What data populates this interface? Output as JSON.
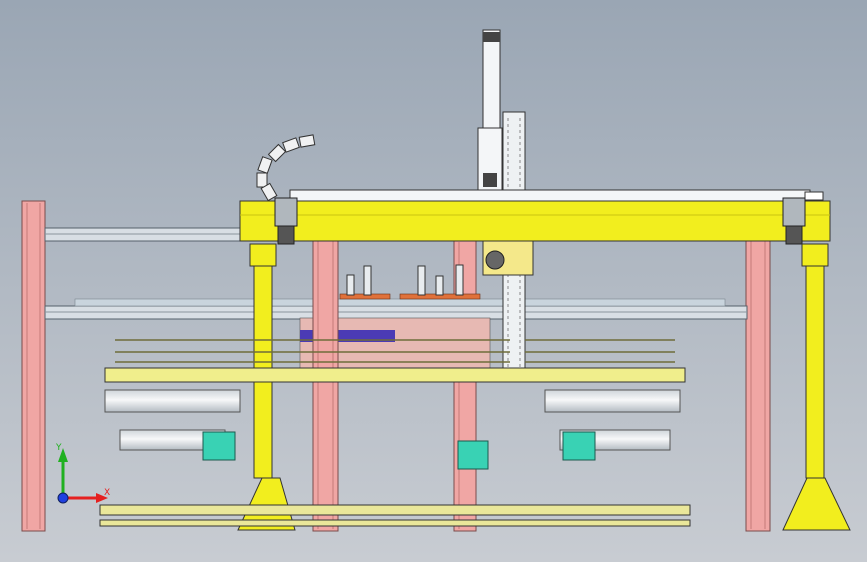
{
  "triad": {
    "y_label": "Y",
    "x_label": "X"
  },
  "colors": {
    "background_top": "#9aa6b4",
    "background_bottom": "#c8ccd2",
    "yellow": "#f2ee1e",
    "yellow_dark": "#c9c410",
    "frame_yellow": "#eae79a",
    "pink_column": "#f0a6a4",
    "pink_column_dark": "#c47a78",
    "rail": "#d8dee4",
    "white": "#f4f6f8",
    "steel": "#b9c3cc",
    "roller": "#e3e7ea",
    "teal": "#39d2b4",
    "orange": "#e0713a",
    "purple": "#4b3bb5",
    "axis_x": "#e52020",
    "axis_y": "#20b020",
    "axis_z": "#2040e0"
  }
}
